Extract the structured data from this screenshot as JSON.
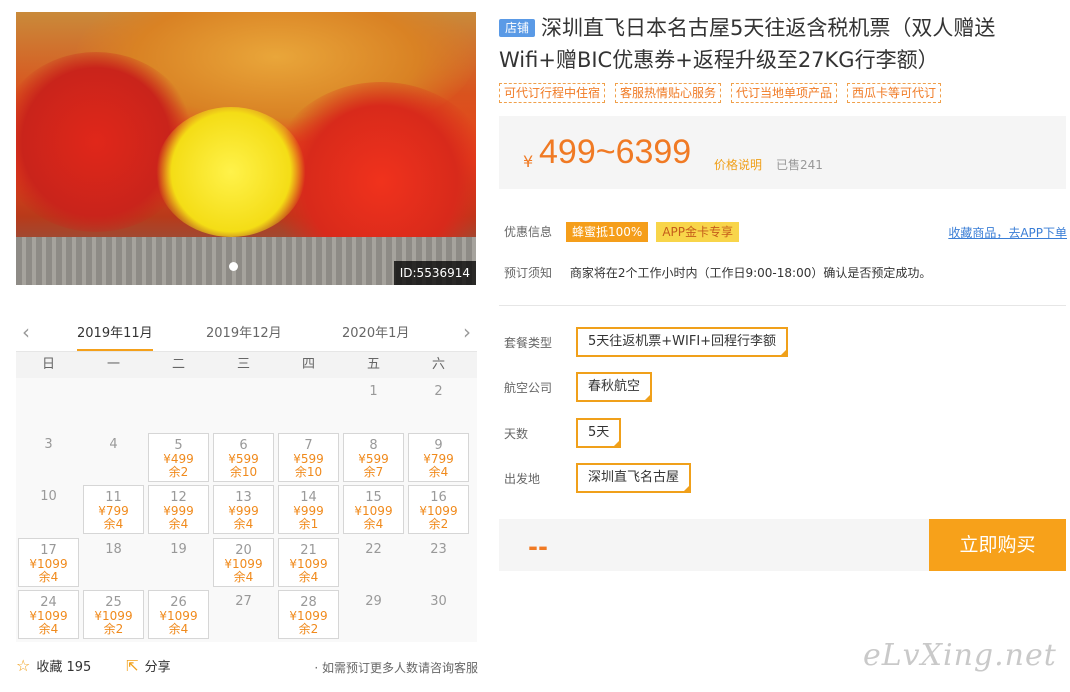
{
  "hero": {
    "image_id": "ID:5536914"
  },
  "calendar": {
    "prev_arrow": "‹",
    "next_arrow": "›",
    "months": [
      "2019年11月",
      "2019年12月",
      "2020年1月"
    ],
    "weekdays": [
      "日",
      "一",
      "二",
      "三",
      "四",
      "五",
      "六"
    ],
    "days": [
      {
        "day": "1"
      },
      {
        "day": "2"
      },
      {
        "day": "3"
      },
      {
        "day": "4"
      },
      {
        "day": "5",
        "price": "¥499",
        "remain": "余2"
      },
      {
        "day": "6",
        "price": "¥599",
        "remain": "余10"
      },
      {
        "day": "7",
        "price": "¥599",
        "remain": "余10"
      },
      {
        "day": "8",
        "price": "¥599",
        "remain": "余7"
      },
      {
        "day": "9",
        "price": "¥799",
        "remain": "余4"
      },
      {
        "day": "10"
      },
      {
        "day": "11",
        "price": "¥799",
        "remain": "余4"
      },
      {
        "day": "12",
        "price": "¥999",
        "remain": "余4"
      },
      {
        "day": "13",
        "price": "¥999",
        "remain": "余4"
      },
      {
        "day": "14",
        "price": "¥999",
        "remain": "余1"
      },
      {
        "day": "15",
        "price": "¥1099",
        "remain": "余4"
      },
      {
        "day": "16",
        "price": "¥1099",
        "remain": "余2"
      },
      {
        "day": "17",
        "price": "¥1099",
        "remain": "余4"
      },
      {
        "day": "18"
      },
      {
        "day": "19"
      },
      {
        "day": "20",
        "price": "¥1099",
        "remain": "余4"
      },
      {
        "day": "21",
        "price": "¥1099",
        "remain": "余4"
      },
      {
        "day": "22"
      },
      {
        "day": "23"
      },
      {
        "day": "24",
        "price": "¥1099",
        "remain": "余4"
      },
      {
        "day": "25",
        "price": "¥1099",
        "remain": "余2"
      },
      {
        "day": "26",
        "price": "¥1099",
        "remain": "余4"
      },
      {
        "day": "27"
      },
      {
        "day": "28",
        "price": "¥1099",
        "remain": "余2"
      },
      {
        "day": "29"
      },
      {
        "day": "30"
      }
    ]
  },
  "footer": {
    "favorite_label": "收藏",
    "favorite_count": "195",
    "share_label": "分享",
    "note": "· 如需预订更多人数请咨询客服"
  },
  "product": {
    "shop_tag": "店铺",
    "title": "深圳直飞日本名古屋5天往返含税机票（双人赠送Wifi+赠BIC优惠券+返程升级至27KG行李额）",
    "tags": [
      "可代订行程中住宿",
      "客服热情贴心服务",
      "代订当地单项产品",
      "西瓜卡等可代订"
    ],
    "currency": "¥",
    "price": "499~6399",
    "price_explain": "价格说明",
    "sold": "已售241",
    "promo_label": "优惠信息",
    "promo_badge1": "蜂蜜抵100%",
    "promo_badge2": "APP金卡专享",
    "fav_app_link": "收藏商品，去APP下单",
    "notice_label": "预订须知",
    "notice_text": "商家将在2个工作小时内（工作日9:00-18:00）确认是否预定成功。",
    "options": [
      {
        "label": "套餐类型",
        "value": "5天往返机票+WIFI+回程行李额"
      },
      {
        "label": "航空公司",
        "value": "春秋航空"
      },
      {
        "label": "天数",
        "value": "5天"
      },
      {
        "label": "出发地",
        "value": "深圳直飞名古屋"
      }
    ],
    "total_placeholder": "--",
    "buy_button": "立即购买"
  },
  "watermark": "eLvXing.net",
  "colors": {
    "accent": "#f7a11a",
    "price": "#f07a24",
    "link": "#3a7ed6"
  }
}
